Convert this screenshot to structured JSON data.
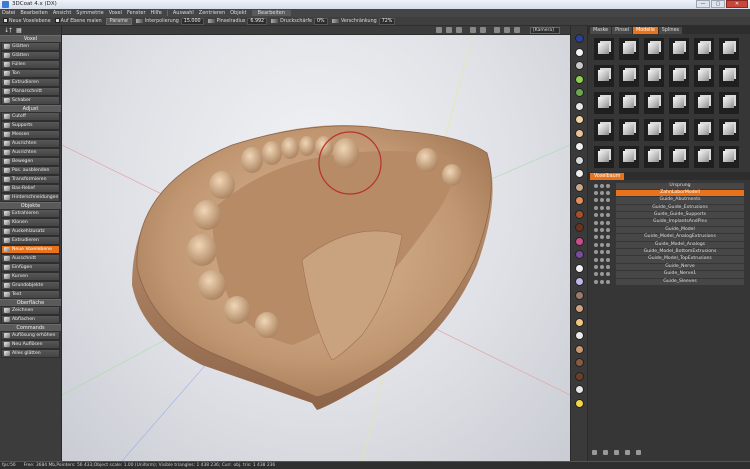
{
  "window": {
    "title": "3DCoat 4.x (DX)",
    "buttons": [
      "—",
      "▢",
      "✕"
    ]
  },
  "menu": [
    "Datei",
    "Bearbeiten",
    "Ansicht",
    "Symmetrie",
    "Voxel",
    "Fenster",
    "Hilfe",
    "Auswahl",
    "Zentrieren",
    "Objekt"
  ],
  "menu_tab": "Bearbeiten",
  "toolbar": {
    "new_voxel_layer": "Neue Voxelebene",
    "on_surface": "Auf Ebene malen",
    "params": "Parame",
    "interp_label": "Interpolierung",
    "interp_val": "15.000",
    "pinsel_label": "Pinselradius",
    "pinsel_val": "6.992",
    "strength_label": "Druckschärfe",
    "strength_val": "0%",
    "smooth_label": "Verschränkung",
    "smooth_val": "72%"
  },
  "camera": "[Kamera]",
  "left_panel": {
    "sections": [
      {
        "title": "Voxel",
        "items": [
          "Glätten",
          "Glätten",
          "Füllen",
          "Ton",
          "Extrudieren",
          "Planarschnitt",
          "Schaber"
        ]
      },
      {
        "title": "Adjust",
        "items": [
          "Cutoff",
          "Supports",
          "Messen",
          "Ausrichten",
          "Ausrichten",
          "Bewegen",
          "Pos. ausblenden",
          "Transformieren",
          "Bas-Relief",
          "Hinterschneidungen"
        ]
      },
      {
        "title": "Objekte",
        "items": [
          "Extrahieren",
          "Klonen",
          "Auskehlzusatz",
          "Extrudieren",
          "Neue Voxelebene",
          "Ausschnitt",
          "Einfügen",
          "Kurven",
          "Grundobjekte",
          "Text"
        ]
      },
      {
        "title": "Oberfläche",
        "items": [
          "Zeichnen",
          "Abflachen"
        ]
      },
      {
        "title": "Commands",
        "items": [
          "Auflösung erhöhen",
          "Neu Auflösen",
          "Alles glätten"
        ]
      }
    ],
    "active_item": "Neue Voxelebene"
  },
  "palette": [
    "#2a3f9a",
    "#f5f5f5",
    "#c9c9c9",
    "#8fd14f",
    "#6ba84a",
    "#e8e8e8",
    "#f0d5a8",
    "#e8c29a",
    "#f1f1f1",
    "#d9d9d9",
    "#eeeeee",
    "#c7a88a",
    "#e48d5a",
    "#a84f2a",
    "#6b3421",
    "#cc4d8c",
    "#7a4aa0",
    "#f2f2f2",
    "#c2b7e6",
    "#9b7a6e",
    "#d1a07c",
    "#f4c57e",
    "#eaeaea",
    "#c79675",
    "#8a5a3c",
    "#6d3f27",
    "#e6e6e6",
    "#f2d64b"
  ],
  "right_panel": {
    "tabs": [
      "Maske",
      "Pinsel",
      "Modelle",
      "Splines"
    ],
    "active_tab": "Modelle",
    "tree_tab": "Voxelbaum",
    "tree": [
      {
        "name": "Ursprung",
        "selected": false
      },
      {
        "name": "ZahnLaborModell",
        "selected": true
      },
      {
        "name": "Guide_Abutments",
        "selected": false
      },
      {
        "name": "Guide_Guide_Extrusions",
        "selected": false
      },
      {
        "name": "Guide_Guide_Supports",
        "selected": false
      },
      {
        "name": "Guide_ImplantsAndPins",
        "selected": false
      },
      {
        "name": "Guide_Model",
        "selected": false
      },
      {
        "name": "Guide_Model_AnalogExtrusions",
        "selected": false
      },
      {
        "name": "Guide_Model_Analogs",
        "selected": false
      },
      {
        "name": "Guide_Model_BottomExtrusions",
        "selected": false
      },
      {
        "name": "Guide_Model_TopExtrusions",
        "selected": false
      },
      {
        "name": "Guide_Nerve",
        "selected": false
      },
      {
        "name": "Guide_Nerve1",
        "selected": false
      },
      {
        "name": "Guide_Sleeves",
        "selected": false
      }
    ]
  },
  "status": {
    "fps": "fps:56",
    "info": "Free: 3684 Mb,Pointers: 56 433;Object scale: 1.00 (Uniform); Visible triangles: 1 438 236; Curr. obj. tris: 1 438 236"
  }
}
